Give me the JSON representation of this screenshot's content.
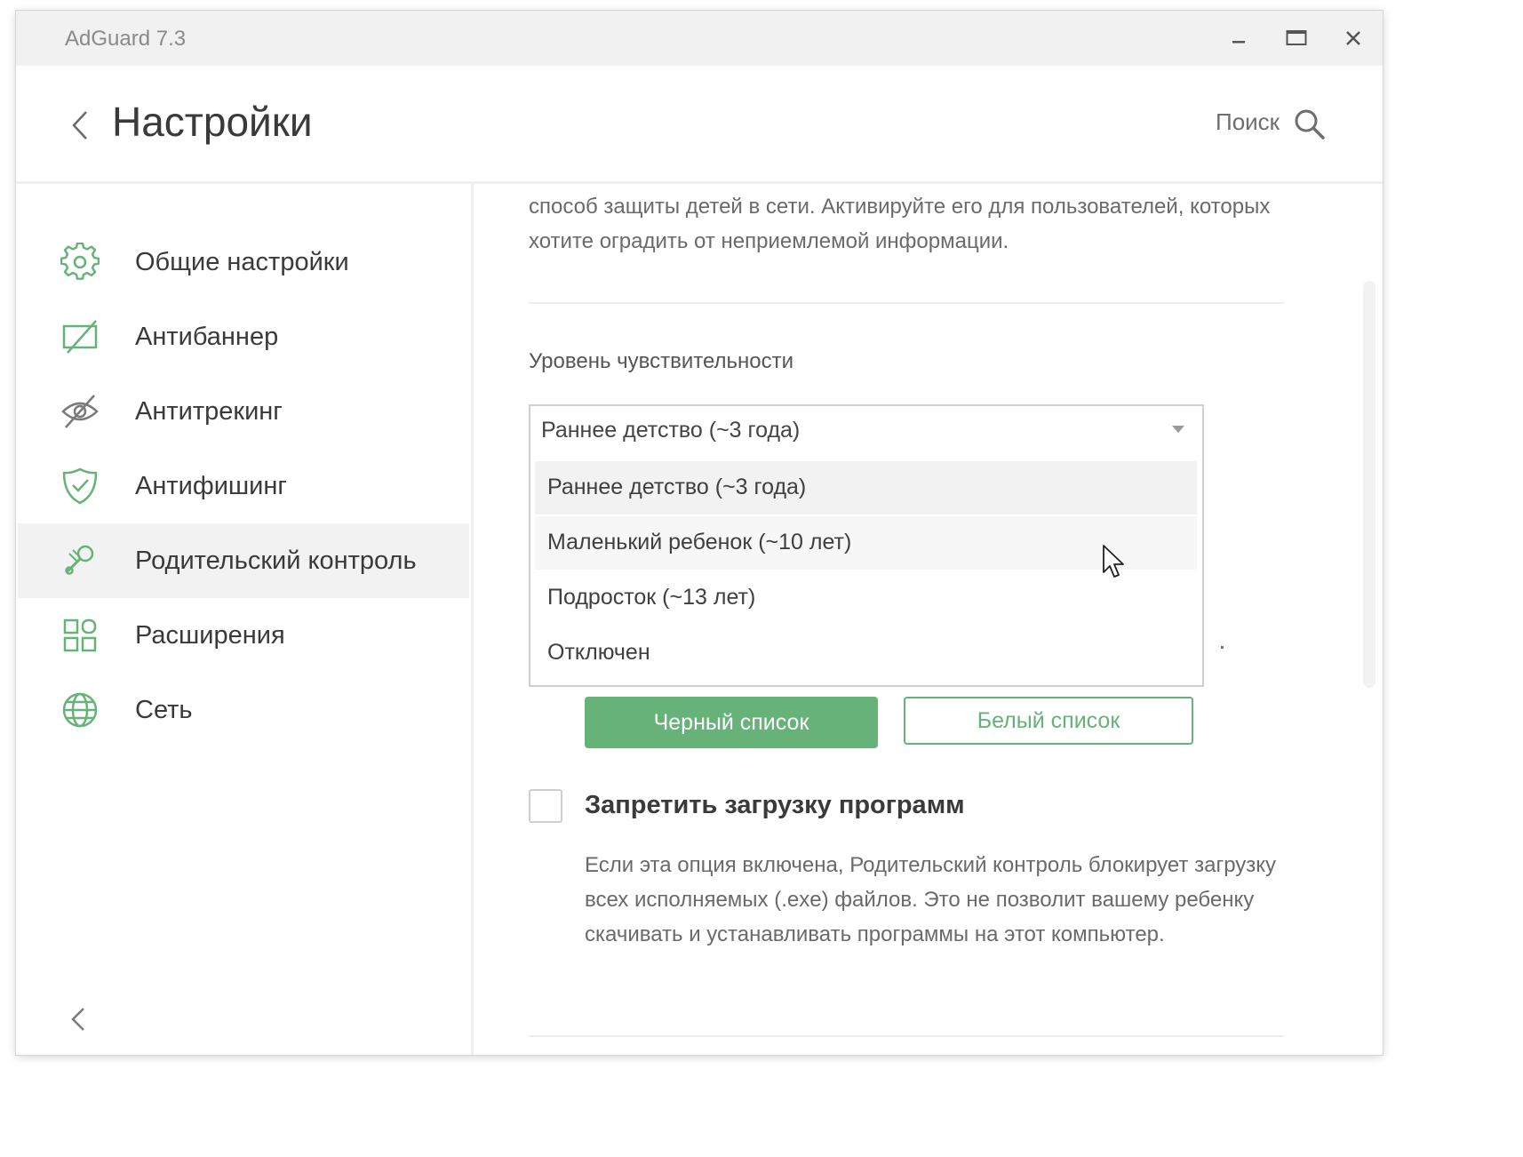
{
  "window": {
    "app_title": "AdGuard 7.3",
    "controls": {
      "minimize": "minimize-icon",
      "maximize": "maximize-icon",
      "close": "close-icon"
    }
  },
  "header": {
    "title": "Настройки",
    "search_label": "Поиск"
  },
  "sidebar": {
    "items": [
      {
        "label": "Общие настройки",
        "icon": "gear-icon",
        "active": false
      },
      {
        "label": "Антибаннер",
        "icon": "crossed-screen-icon",
        "active": false
      },
      {
        "label": "Антитрекинг",
        "icon": "crossed-eye-icon",
        "active": false
      },
      {
        "label": "Антифишинг",
        "icon": "shield-check-icon",
        "active": false
      },
      {
        "label": "Родительский контроль",
        "icon": "rattle-icon",
        "active": true
      },
      {
        "label": "Расширения",
        "icon": "grid-icon",
        "active": false
      },
      {
        "label": "Сеть",
        "icon": "globe-icon",
        "active": false
      }
    ]
  },
  "content": {
    "intro_text": "способ защиты детей в сети. Активируйте его для пользователей, которых хотите оградить от неприемлемой информации.",
    "sensitivity": {
      "label": "Уровень чувствительности",
      "selected": "Раннее детство (~3 года)",
      "options": [
        "Раннее детство (~3 года)",
        "Маленький ребенок (~10 лет)",
        "Подросток (~13 лет)",
        "Отключен"
      ]
    },
    "buttons": {
      "blacklist": "Черный список",
      "whitelist": "Белый список"
    },
    "block_downloads": {
      "title": "Запретить загрузку программ",
      "checked": false,
      "description": "Если эта опция включена, Родительский контроль блокирует загрузку всех исполняемых (.exe) файлов. Это не позволит вашему ребенку скачивать и устанавливать программы на этот компьютер."
    }
  },
  "colors": {
    "accent": "#67b279",
    "active_bg": "#f2f2f2",
    "titlebar_bg": "#f1f1f1"
  }
}
